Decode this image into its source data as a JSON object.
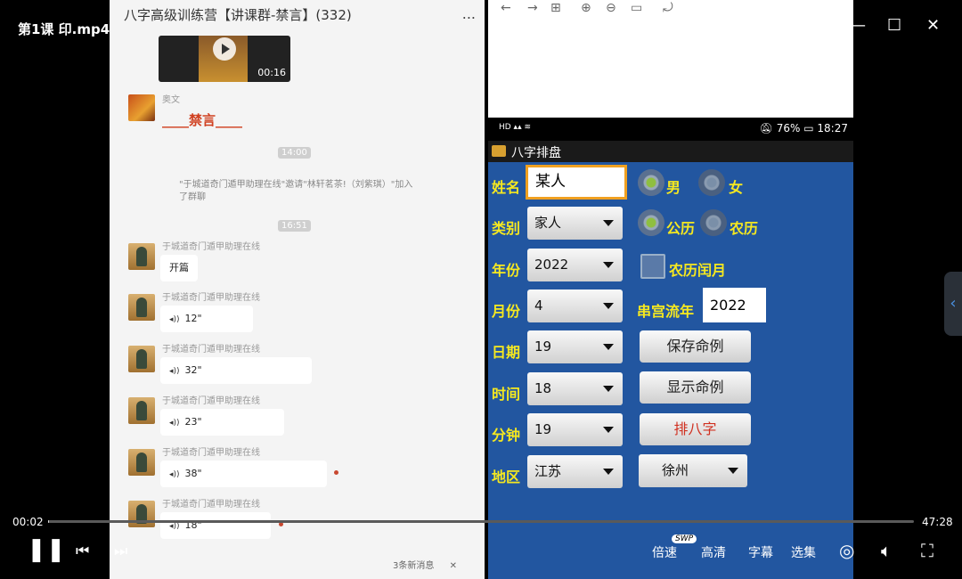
{
  "player": {
    "title": "第1课 印.mp4",
    "time_current": "00:02",
    "time_total": "47:28",
    "progress": 0.0007,
    "controls": {
      "speed": "倍速",
      "speed_badge": "SWP",
      "quality": "高清",
      "subtitle": "字幕",
      "episodes": "选集"
    },
    "icons": [
      "share-icon",
      "download-icon",
      "more-icon",
      "picture-in-picture-icon",
      "pin-icon",
      "minimize-icon",
      "maximize-icon",
      "close-icon",
      "pause-icon",
      "prev-icon",
      "next-icon",
      "settings-icon",
      "volume-icon",
      "fullscreen-icon",
      "side-collapse-icon"
    ]
  },
  "chat": {
    "title": "八字高级训练营【讲课群-禁言】(332)",
    "more": "...",
    "video_duration": "00:16",
    "first_sender": "奥文",
    "banned_text": "____禁言____",
    "time1": "14:00",
    "system_message": "\"于城道奇门遁甲助理在线\"邀请\"林轩茗茶!（刘紫琪）\"加入了群聊",
    "time2": "16:51",
    "sender": "于城道奇门遁甲助理在线",
    "first_message": "开篇",
    "voice_messages": [
      "12\"",
      "32\"",
      "23\"",
      "38\"",
      "18\""
    ],
    "new_messages": "3条新消息",
    "new_messages_close": "✕"
  },
  "app": {
    "status_time": "18:27",
    "battery": "76%",
    "app_title": "八字排盘",
    "labels": {
      "name": "姓名",
      "category": "类别",
      "year": "年份",
      "month": "月份",
      "day": "日期",
      "hour": "时间",
      "minute": "分钟",
      "region": "地区"
    },
    "name_value": "某人",
    "gender": {
      "male": "男",
      "female": "女",
      "selected": "male"
    },
    "calendar": {
      "solar": "公历",
      "lunar": "农历",
      "selected": "solar"
    },
    "lunar_leap": "农历闰月",
    "flow_year_label": "串宫流年",
    "flow_year_value": "2022",
    "category_value": "家人",
    "year_value": "2022",
    "month_value": "4",
    "day_value": "19",
    "hour_value": "18",
    "minute_value": "19",
    "province_value": "江苏",
    "city_value": "徐州",
    "buttons": {
      "save": "保存命例",
      "show": "显示命例",
      "compute": "排八字"
    }
  }
}
